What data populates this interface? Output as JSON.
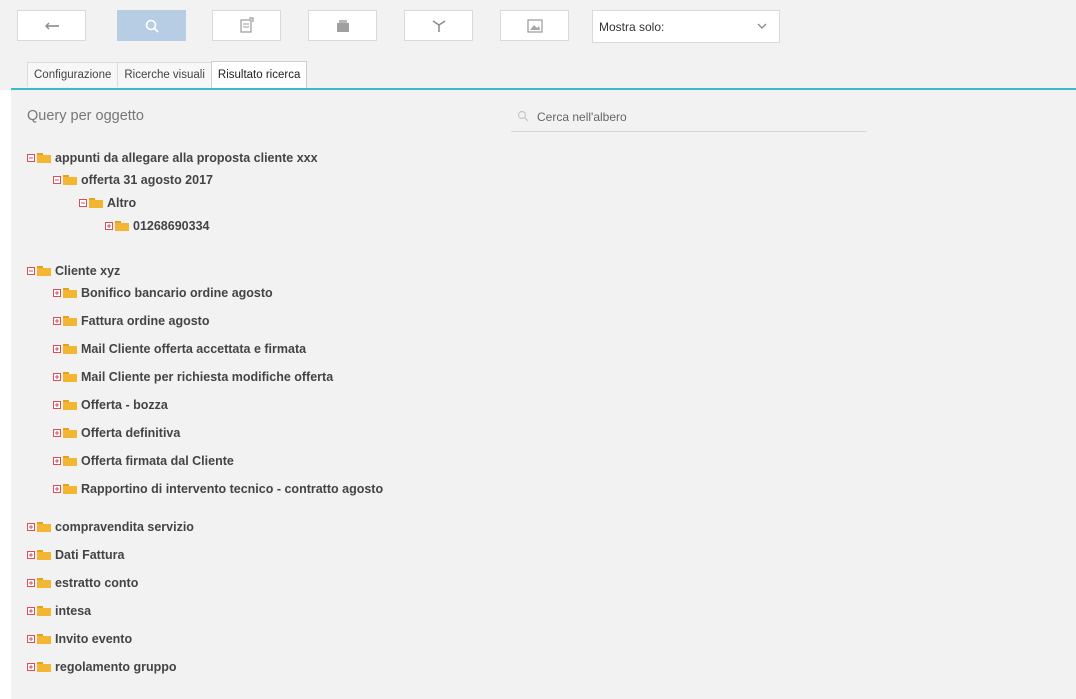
{
  "toolbar": {
    "buttons": [
      {
        "name": "back",
        "icon": "arrow-left-icon"
      },
      {
        "name": "search",
        "icon": "search-icon",
        "active": true
      },
      {
        "name": "export",
        "icon": "export-icon"
      },
      {
        "name": "folder",
        "icon": "folder-icon"
      },
      {
        "name": "filter",
        "icon": "filter-icon"
      },
      {
        "name": "image",
        "icon": "image-icon"
      }
    ],
    "select": {
      "value": "Mostra solo:"
    }
  },
  "tabs": [
    {
      "label": "Configurazione",
      "active": false
    },
    {
      "label": "Ricerche visuali",
      "active": false
    },
    {
      "label": "Risultato ricerca",
      "active": true
    }
  ],
  "main": {
    "title": "Query per oggetto",
    "search_placeholder": "Cerca nell'albero"
  },
  "colors": {
    "accent": "#3cbcc6",
    "active_button": "#b7cde3",
    "folder": "#f2b632",
    "expander": "#d94e5a"
  },
  "tree": [
    {
      "label": "appunti da allegare alla proposta cliente xxx",
      "level": 0,
      "expanded": true
    },
    {
      "label": "offerta 31 agosto 2017",
      "level": 1,
      "expanded": true
    },
    {
      "label": "Altro",
      "level": 2,
      "expanded": true
    },
    {
      "label": "01268690334",
      "level": 3,
      "expanded": false
    },
    {
      "label": "Cliente xyz",
      "level": 0,
      "expanded": true
    },
    {
      "label": "Bonifico bancario ordine agosto",
      "level": 1,
      "expanded": false
    },
    {
      "label": "Fattura ordine agosto",
      "level": 1,
      "expanded": false
    },
    {
      "label": "Mail Cliente offerta accettata e firmata",
      "level": 1,
      "expanded": false
    },
    {
      "label": "Mail Cliente per richiesta modifiche offerta",
      "level": 1,
      "expanded": false
    },
    {
      "label": "Offerta - bozza",
      "level": 1,
      "expanded": false
    },
    {
      "label": "Offerta definitiva",
      "level": 1,
      "expanded": false
    },
    {
      "label": "Offerta firmata dal Cliente",
      "level": 1,
      "expanded": false
    },
    {
      "label": "Rapportino di intervento tecnico - contratto agosto",
      "level": 1,
      "expanded": false
    },
    {
      "label": "compravendita servizio",
      "level": 0,
      "expanded": false
    },
    {
      "label": "Dati Fattura",
      "level": 0,
      "expanded": false
    },
    {
      "label": "estratto conto",
      "level": 0,
      "expanded": false
    },
    {
      "label": "intesa",
      "level": 0,
      "expanded": false
    },
    {
      "label": "Invito evento",
      "level": 0,
      "expanded": false
    },
    {
      "label": "regolamento gruppo",
      "level": 0,
      "expanded": false
    }
  ]
}
